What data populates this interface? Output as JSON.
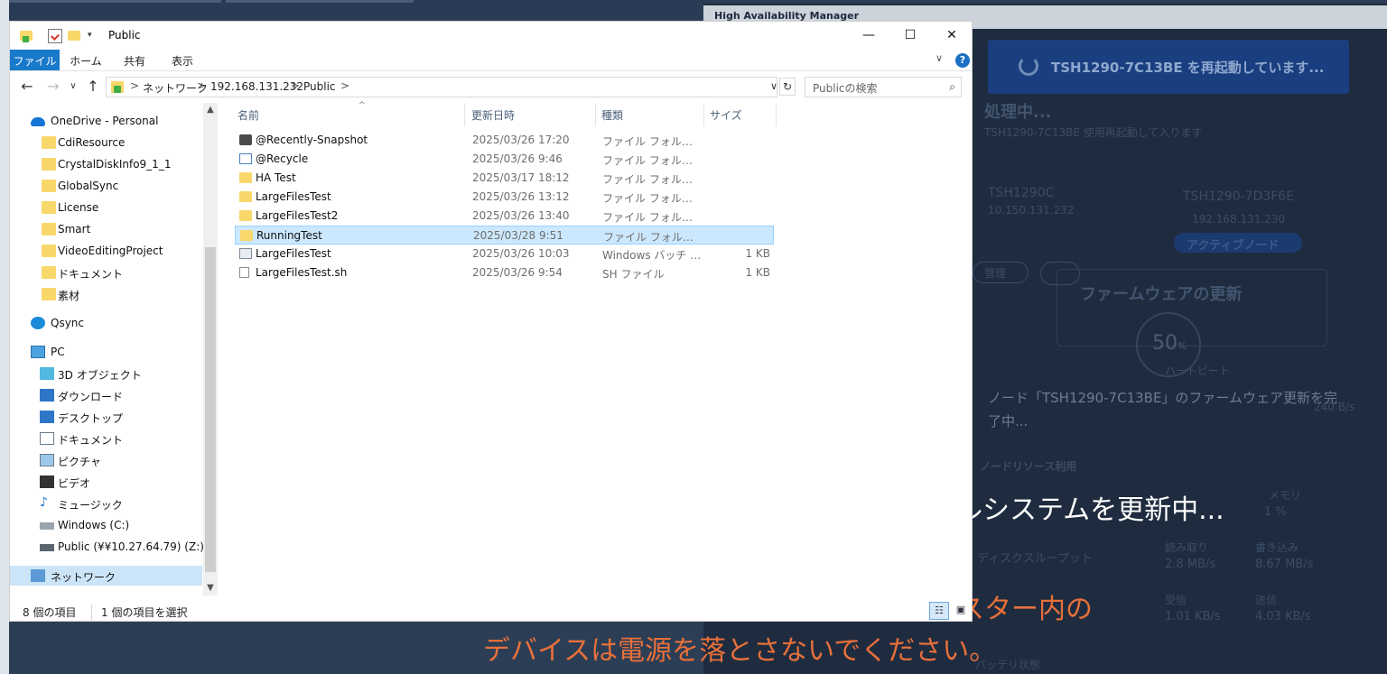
{
  "background": {
    "panel_title": "High Availability Manager",
    "banner_text": "TSH1290-7C13BE を再起動しています...",
    "processing_title": "処理中...",
    "processing_sub": "TSH1290-7C13BE 使用再起動して入ります",
    "node1_name": "TSH1290C",
    "node1_ip": "10.150.131.232",
    "node2_name": "TSH1290-7D3F6E",
    "node2_ip": "192.168.131.230",
    "active_node": "アクティブノード",
    "admin_label": "管理",
    "firmware_update": "ファームウェアの更新",
    "gauge": "50",
    "gauge_unit": "%",
    "heartbeat": "ハートビート",
    "node_msg_line1": "ノード「TSH1290-7C13BE」のファームウェア更新を完",
    "node_msg_line2": "了中...",
    "bandwidth": "240 B/s",
    "resource_title": "ノードリソース利用",
    "memory_label": "メモリ",
    "memory_val": "1 %",
    "sys_update": "システムを更新中...",
    "disk_throughput": "ディスクスループット",
    "read_label": "読み取り",
    "read_val": "2.8 MB/s",
    "write_label": "書き込み",
    "write_val": "8.67 MB/s",
    "recv_label": "受信",
    "recv_val": "1.01 KB/s",
    "send_label": "送信",
    "send_val": "4.03 KB/s",
    "warn_line1": "スター内の",
    "warn_line2": "デバイスは電源を落とさないでください。",
    "fragment_sys": "ル",
    "bottom_fragment": "バッテリ状態"
  },
  "window": {
    "title": "Public",
    "minimize": "—",
    "maximize": "☐",
    "close": "✕",
    "ribbon_tabs": [
      "ファイル",
      "ホーム",
      "共有",
      "表示"
    ],
    "ribbon_collapse": "∨",
    "help": "?"
  },
  "address": {
    "back": "←",
    "forward": "→",
    "recent": "∨",
    "up": "↑",
    "crumbs": [
      "ネットワーク",
      "192.168.131.232",
      "Public"
    ],
    "separator": ">",
    "dropdown": "∨",
    "refresh": "↻",
    "search_placeholder": "Publicの検索",
    "search_icon": "⌕"
  },
  "nav": {
    "items": [
      {
        "label": "OneDrive - Personal",
        "icon": "cloud-icon"
      },
      {
        "label": "CdiResource",
        "icon": "folder-icon"
      },
      {
        "label": "CrystalDiskInfo9_1_1",
        "icon": "folder-icon"
      },
      {
        "label": "GlobalSync",
        "icon": "folder-icon"
      },
      {
        "label": "License",
        "icon": "folder-icon"
      },
      {
        "label": "Smart",
        "icon": "folder-icon"
      },
      {
        "label": "VideoEditingProject",
        "icon": "folder-icon"
      },
      {
        "label": "ドキュメント",
        "icon": "folder-icon"
      },
      {
        "label": "素材",
        "icon": "folder-icon"
      },
      {
        "label": "Qsync",
        "icon": "sync-icon"
      },
      {
        "label": "PC",
        "icon": "pc-icon"
      },
      {
        "label": "3D オブジェクト",
        "icon": "cube-icon"
      },
      {
        "label": "ダウンロード",
        "icon": "download-icon"
      },
      {
        "label": "デスクトップ",
        "icon": "desktop-icon"
      },
      {
        "label": "ドキュメント",
        "icon": "document-icon"
      },
      {
        "label": "ピクチャ",
        "icon": "picture-icon"
      },
      {
        "label": "ビデオ",
        "icon": "video-icon"
      },
      {
        "label": "ミュージック",
        "icon": "music-icon"
      },
      {
        "label": "Windows  (C:)",
        "icon": "drive-icon"
      },
      {
        "label": "Public (¥¥10.27.64.79) (Z:)",
        "icon": "network-drive-icon"
      },
      {
        "label": "ネットワーク",
        "icon": "network-icon"
      }
    ]
  },
  "columns": {
    "name": "名前",
    "date": "更新日時",
    "type": "種類",
    "size": "サイズ",
    "sort": "^"
  },
  "files": [
    {
      "name": "@Recently-Snapshot",
      "date": "2025/03/26 17:20",
      "type": "ファイル フォルダー",
      "size": "",
      "icon": "camera-folder-icon"
    },
    {
      "name": "@Recycle",
      "date": "2025/03/26 9:46",
      "type": "ファイル フォルダー",
      "size": "",
      "icon": "recycle-folder-icon"
    },
    {
      "name": "HA Test",
      "date": "2025/03/17 18:12",
      "type": "ファイル フォルダー",
      "size": "",
      "icon": "folder-icon"
    },
    {
      "name": "LargeFilesTest",
      "date": "2025/03/26 13:12",
      "type": "ファイル フォルダー",
      "size": "",
      "icon": "folder-icon"
    },
    {
      "name": "LargeFilesTest2",
      "date": "2025/03/26 13:40",
      "type": "ファイル フォルダー",
      "size": "",
      "icon": "folder-icon"
    },
    {
      "name": "RunningTest",
      "date": "2025/03/28 9:51",
      "type": "ファイル フォルダー",
      "size": "",
      "icon": "folder-icon"
    },
    {
      "name": "LargeFilesTest",
      "date": "2025/03/26 10:03",
      "type": "Windows バッチ ファ...",
      "size": "1 KB",
      "icon": "batch-file-icon"
    },
    {
      "name": "LargeFilesTest.sh",
      "date": "2025/03/26 9:54",
      "type": "SH ファイル",
      "size": "1 KB",
      "icon": "file-icon"
    }
  ],
  "status": {
    "count": "8 個の項目",
    "selected": "1 個の項目を選択",
    "view_details": "☷",
    "view_large": "▣"
  }
}
